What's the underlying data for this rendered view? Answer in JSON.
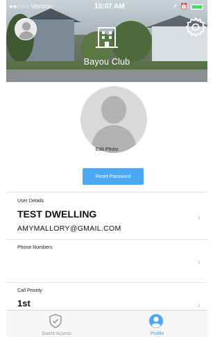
{
  "status_bar": {
    "carrier": "●●○○○ Verizon",
    "time": "10:07 AM",
    "battery_color": "#4cd964"
  },
  "header": {
    "club_name": "Bayou Club",
    "icons": [
      "avatar",
      "building-logo-icon",
      "gear-icon"
    ]
  },
  "profile": {
    "edit_photo_label": "Edit Photo",
    "reset_password_label": "Reset Password",
    "accent_color": "#4aa9f0"
  },
  "sections": {
    "user_details": {
      "label": "User Details",
      "name": "TEST DWELLING",
      "email": "AMYMALLORY@GMAIL.COM"
    },
    "phone_numbers": {
      "label": "Phone Numbers"
    },
    "call_priority": {
      "label": "Call Priority",
      "value": "1st"
    }
  },
  "tabbar": {
    "tabs": [
      {
        "label": "Guest Access",
        "icon": "shield-check-icon"
      },
      {
        "label": "Profile",
        "icon": "person-circle-icon",
        "active": true
      }
    ]
  }
}
